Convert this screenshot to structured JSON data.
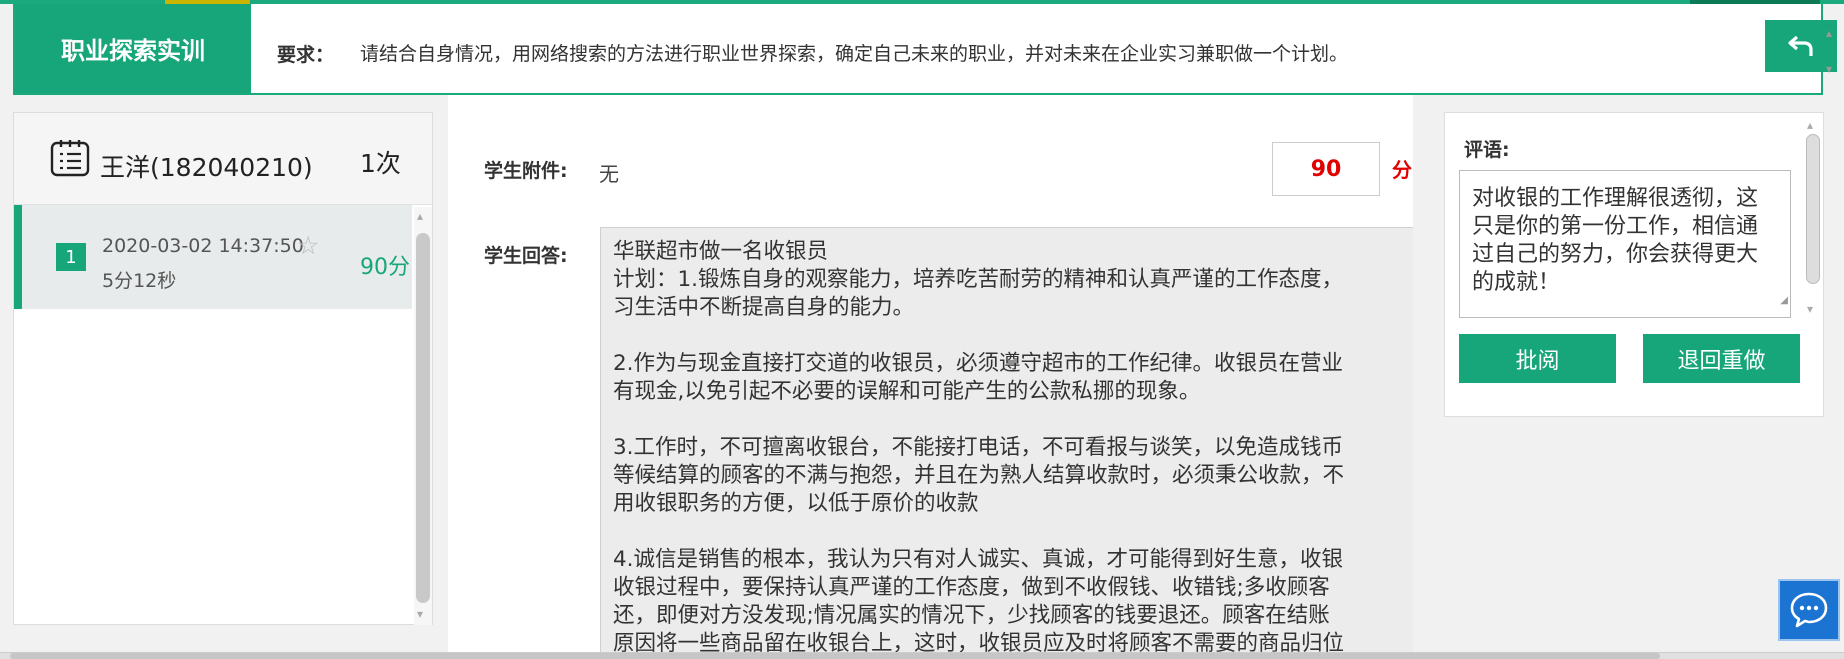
{
  "header": {
    "title": "职业探索实训",
    "requirement_label": "要求：",
    "requirement_text": "请结合自身情况，用网络搜索的方法进行职业世界探索，确定自己未来的职业，并对未来在企业实习兼职做一个计划。"
  },
  "student": {
    "name": "王洋(182040210)",
    "count": "1次"
  },
  "submission": {
    "index": "1",
    "datetime": "2020-03-02 14:37:50",
    "duration": "5分12秒",
    "score": "90分"
  },
  "grading": {
    "attachment_label": "学生附件:",
    "attachment_value": "无",
    "score_value": "90",
    "score_unit": "分",
    "answer_label": "学生回答:",
    "answer_text": "华联超市做一名收银员\n计划：1.锻炼自身的观察能力，培养吃苦耐劳的精神和认真严谨的工作态度，\n习生活中不断提高自身的能力。\n\n2.作为与现金直接打交道的收银员，必须遵守超市的工作纪律。收银员在营业\n有现金,以免引起不必要的误解和可能产生的公款私挪的现象。\n\n3.工作时，不可擅离收银台，不能接打电话，不可看报与谈笑，以免造成钱币\n等候结算的顾客的不满与抱怨，并且在为熟人结算收款时，必须秉公收款，不\n用收银职务的方便，以低于原价的收款\n\n4.诚信是销售的根本，我认为只有对人诚实、真诚，才可能得到好生意，收银\n收银过程中，要保持认真严谨的工作态度，做到不收假钱、收错钱;多收顾客\n还，即便对方没发现;情况属实的情况下，少找顾客的钱要退还。顾客在结账\n原因将一些商品留在收银台上，这时，收银员应及时将顾客不需要的商品归位"
  },
  "review": {
    "comment_label": "评语:",
    "comment_text": "对收银的工作理解很透彻，这只是你的第一份工作，相信通过自己的努力，你会获得更大的成就！",
    "review_button": "批阅",
    "redo_button": "退回重做"
  },
  "colors": {
    "accent": "#17a679",
    "score_red": "#e00000",
    "chat_blue": "#1b74d2"
  },
  "icons": {
    "back": "back-arrow-icon",
    "student": "list-document-icon",
    "star": "star-outline-icon",
    "chat": "chat-bubble-icon"
  }
}
